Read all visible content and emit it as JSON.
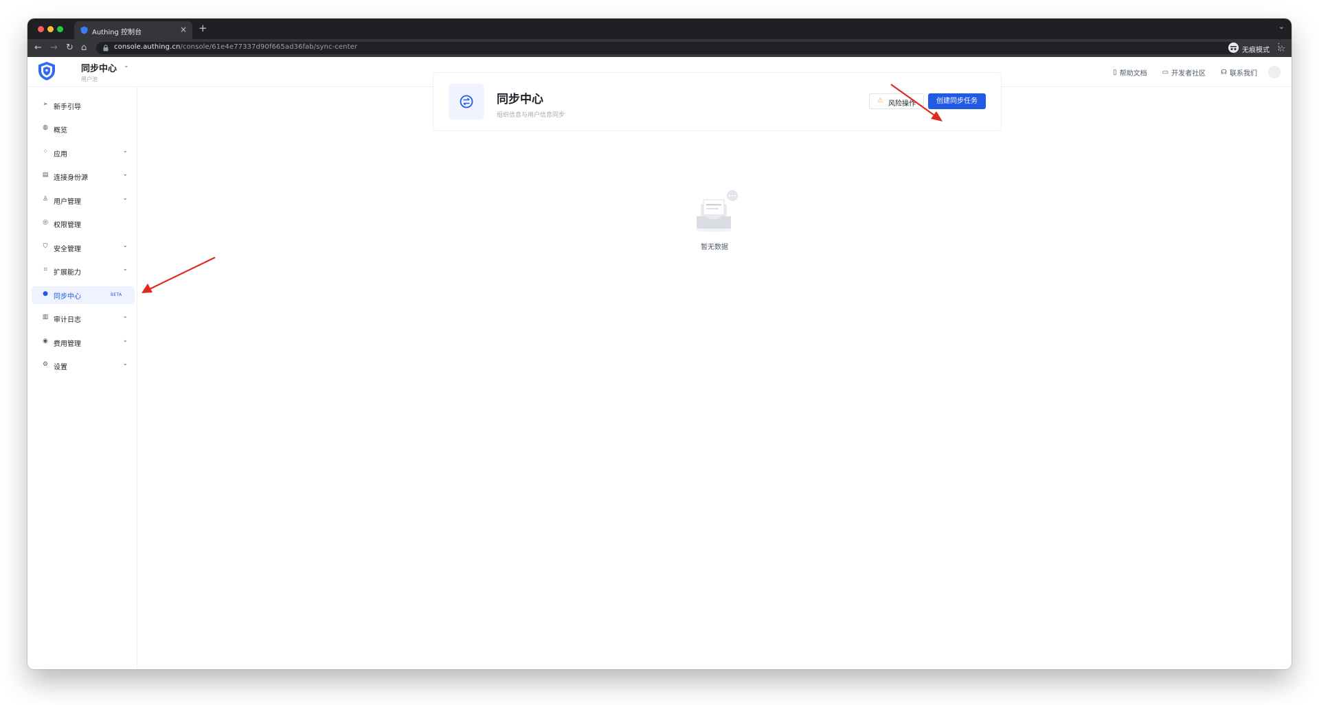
{
  "browser": {
    "tab_title": "Authing 控制台",
    "tab_close": "×",
    "new_tab": "+",
    "url_host": "console.authing.cn",
    "url_path": "/console/61e4e77337d90f665ad36fab/sync-center",
    "incognito_label": "无痕模式"
  },
  "header": {
    "app_title": "同步中心",
    "app_subtitle": "用户池",
    "links": [
      "帮助文档",
      "开发者社区",
      "联系我们"
    ]
  },
  "sidebar": {
    "items": [
      {
        "label": "新手引导",
        "icon": "send-icon",
        "chevron": false
      },
      {
        "label": "概览",
        "icon": "dashboard-icon",
        "chevron": false
      },
      {
        "label": "应用",
        "icon": "apps-icon",
        "chevron": true
      },
      {
        "label": "连接身份源",
        "icon": "connection-icon",
        "chevron": true
      },
      {
        "label": "用户管理",
        "icon": "user-icon",
        "chevron": true
      },
      {
        "label": "权限管理",
        "icon": "permission-icon",
        "chevron": false
      },
      {
        "label": "安全管理",
        "icon": "shield-icon",
        "chevron": true
      },
      {
        "label": "扩展能力",
        "icon": "extension-icon",
        "chevron": true
      },
      {
        "label": "同步中心",
        "icon": "sync-icon",
        "chevron": false,
        "active": true,
        "badge": "BETA"
      },
      {
        "label": "审计日志",
        "icon": "log-icon",
        "chevron": true
      },
      {
        "label": "费用管理",
        "icon": "billing-icon",
        "chevron": true
      },
      {
        "label": "设置",
        "icon": "settings-icon",
        "chevron": true
      }
    ]
  },
  "main": {
    "card_title": "同步中心",
    "card_description": "组织信息与用户信息同步",
    "risk_button": "风险操作",
    "create_button": "创建同步任务",
    "empty_text": "暂无数据"
  },
  "colors": {
    "primary": "#215ae5",
    "annotation_arrow": "#e0281f",
    "active_bg": "#eef3ff"
  }
}
